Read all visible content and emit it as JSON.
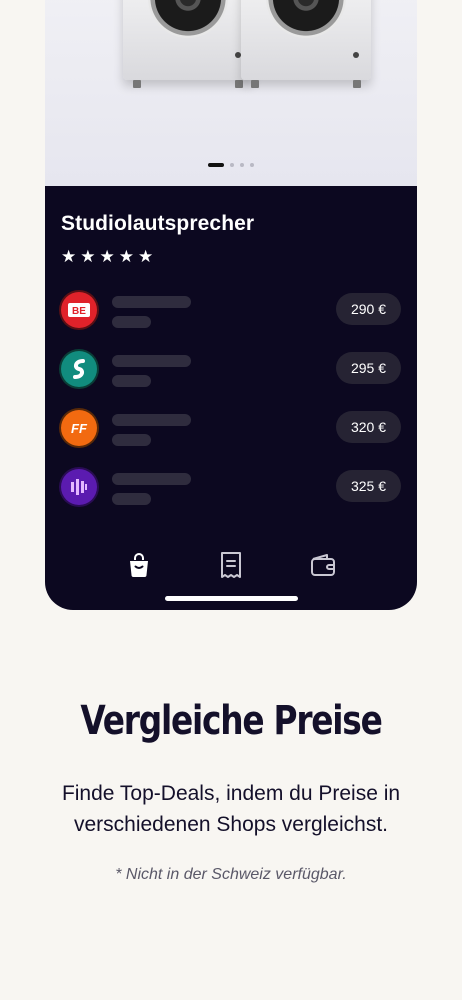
{
  "hero": {
    "image": "speakers-photo",
    "carousel_total": 4,
    "carousel_active": 1
  },
  "product": {
    "title": "Studiolautsprecher",
    "rating": 5,
    "star_icon": "star-icon"
  },
  "offers": [
    {
      "shop_logo": "shop-logo-red-icon",
      "color": "#e0222a",
      "logo_text": "BE",
      "price": "290 €"
    },
    {
      "shop_logo": "shop-logo-teal-icon",
      "color": "#118c7e",
      "logo_text": "S",
      "price": "295 €"
    },
    {
      "shop_logo": "shop-logo-orange-icon",
      "color": "#f26a10",
      "logo_text": "FF",
      "price": "320 €"
    },
    {
      "shop_logo": "shop-logo-purple-icon",
      "color": "#5b1bb0",
      "logo_text": "",
      "price": "325 €"
    }
  ],
  "tabbar": {
    "items": [
      "shopping-bag-icon",
      "receipt-icon",
      "wallet-icon"
    ],
    "active": 0
  },
  "marketing": {
    "headline": "Vergleiche Preise",
    "subline_1": "Finde Top-Deals, indem du Preise in",
    "subline_2": "verschiedenen Shops vergleichst.",
    "note": "* Nicht in der Schweiz verfügbar."
  },
  "colors": {
    "page_bg": "#f8f6f2",
    "phone_bg": "#0c0820",
    "price_pill": "#262333",
    "headline": "#14102a"
  }
}
